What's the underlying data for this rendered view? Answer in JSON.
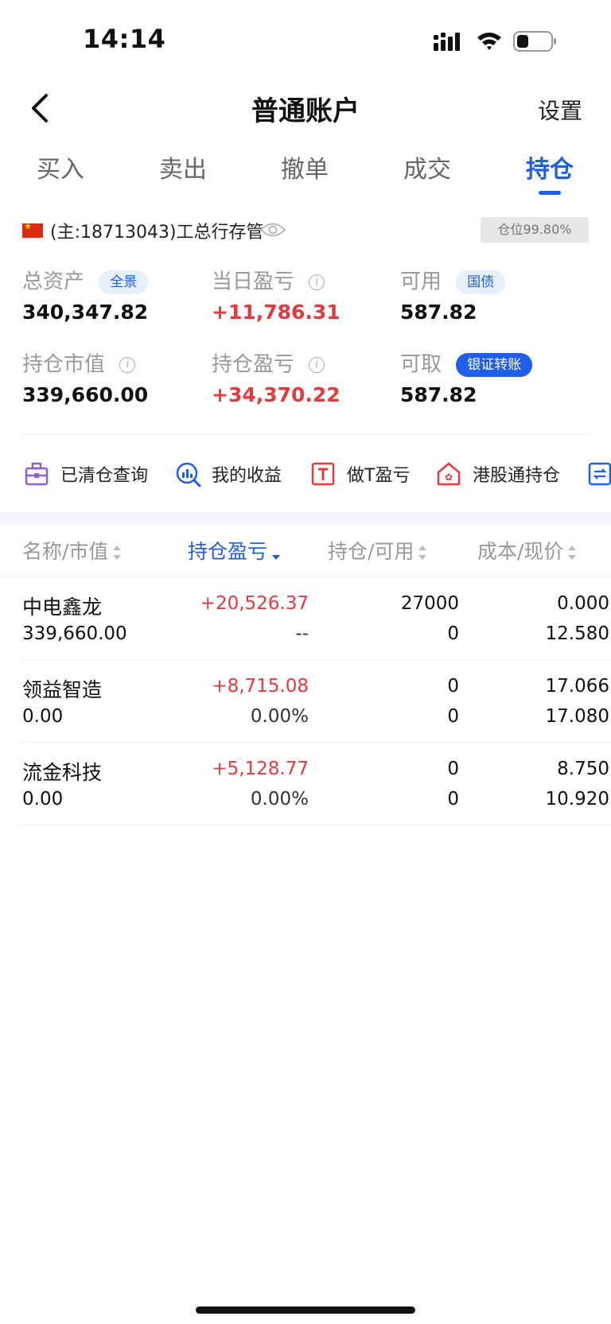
{
  "status_bar": {
    "time": "14:14"
  },
  "nav": {
    "title": "普通账户",
    "settings": "设置"
  },
  "tabs": [
    {
      "label": "买入"
    },
    {
      "label": "卖出"
    },
    {
      "label": "撤单"
    },
    {
      "label": "成交"
    },
    {
      "label": "持仓",
      "active": true
    }
  ],
  "account": {
    "text": "(主:18713043)工总行存管",
    "position_ratio": "仓位99.80%"
  },
  "assets": {
    "total": {
      "label": "总资产",
      "tag": "全景",
      "value": "340,347.82"
    },
    "daily_pl": {
      "label": "当日盈亏",
      "value": "+11,786.31"
    },
    "available": {
      "label": "可用",
      "tag": "国债",
      "value": "587.82"
    },
    "market_value": {
      "label": "持仓市值",
      "value": "339,660.00"
    },
    "position_pl": {
      "label": "持仓盈亏",
      "value": "+34,370.22"
    },
    "withdrawable": {
      "label": "可取",
      "tag": "银证转账",
      "value": "587.82"
    }
  },
  "shortcuts": [
    {
      "label": "已清仓查询",
      "icon": "briefcase-icon"
    },
    {
      "label": "我的收益",
      "icon": "chart-search-icon"
    },
    {
      "label": "做T盈亏",
      "icon": "t-box-icon"
    },
    {
      "label": "港股通持仓",
      "icon": "hk-house-icon"
    },
    {
      "label": "",
      "icon": "transfer-icon"
    }
  ],
  "table": {
    "headers": [
      "名称/市值",
      "持仓盈亏",
      "持仓/可用",
      "成本/现价"
    ],
    "rows": [
      {
        "name": "中电鑫龙",
        "market_value": "339,660.00",
        "pl": "+20,526.37",
        "pl_pct": "--",
        "position": "27000",
        "available": "0",
        "cost": "0.000",
        "price": "12.580"
      },
      {
        "name": "领益智造",
        "market_value": "0.00",
        "pl": "+8,715.08",
        "pl_pct": "0.00%",
        "position": "0",
        "available": "0",
        "cost": "17.066",
        "price": "17.080"
      },
      {
        "name": "流金科技",
        "market_value": "0.00",
        "pl": "+5,128.77",
        "pl_pct": "0.00%",
        "position": "0",
        "available": "0",
        "cost": "8.750",
        "price": "10.920"
      }
    ]
  },
  "colors": {
    "accent": "#1f5ee6",
    "profit": "#e33b3b"
  }
}
